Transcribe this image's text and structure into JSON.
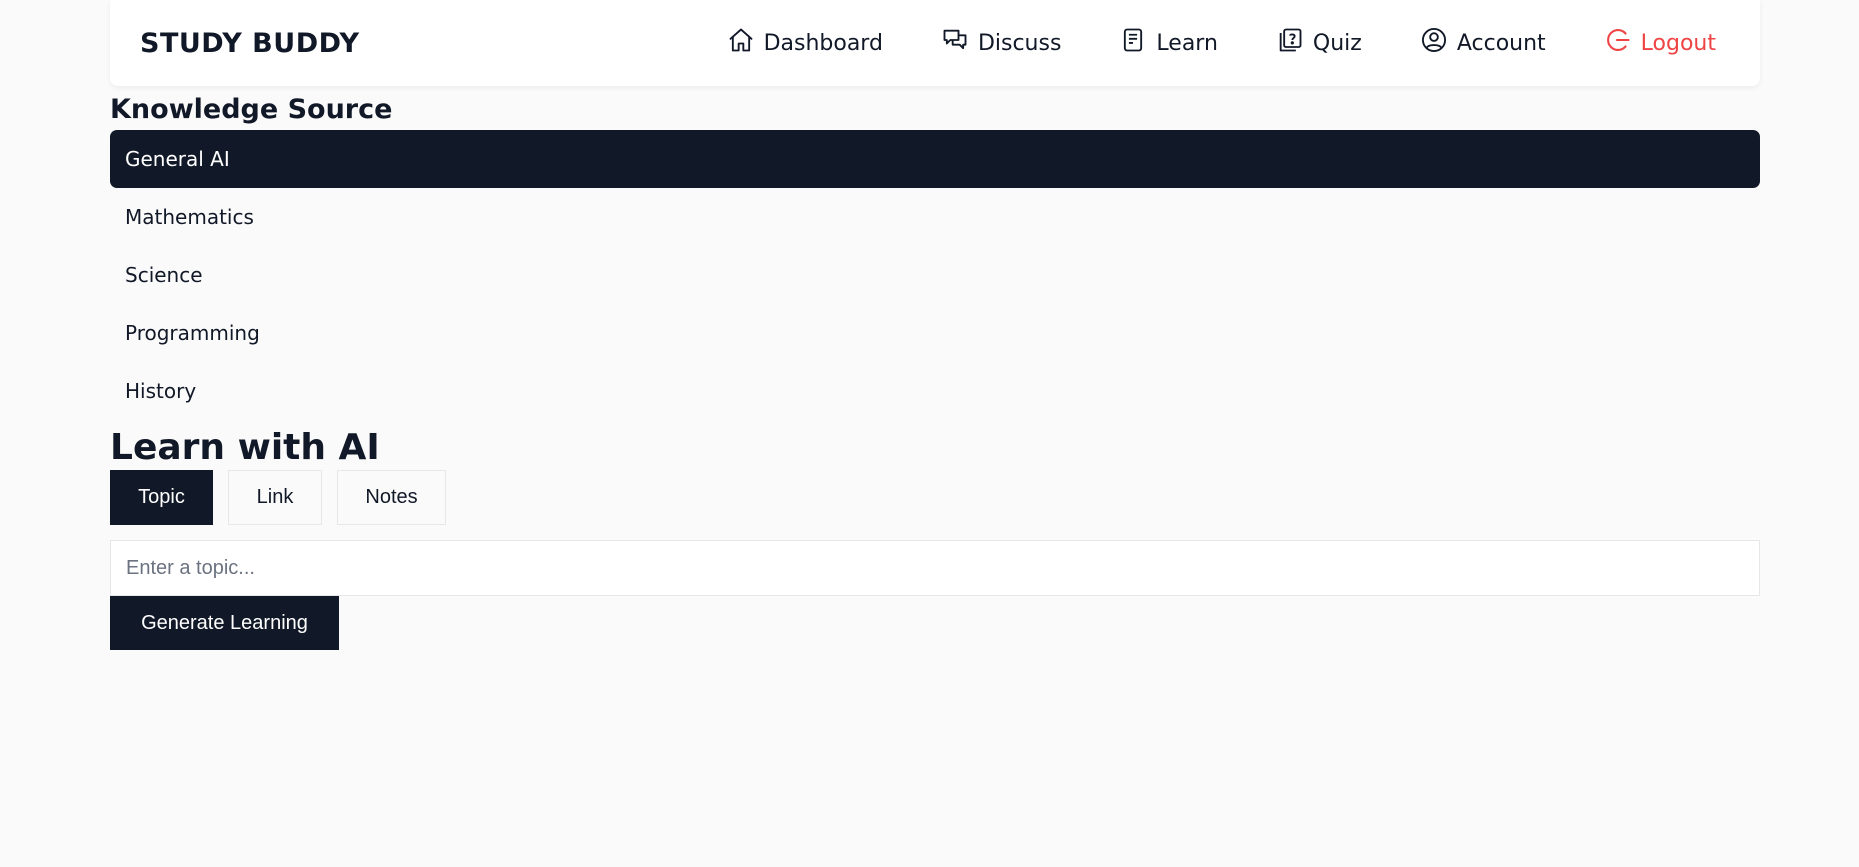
{
  "brand": "STUDY BUDDY",
  "nav": {
    "dashboard": "Dashboard",
    "discuss": "Discuss",
    "learn": "Learn",
    "quiz": "Quiz",
    "account": "Account",
    "logout": "Logout"
  },
  "knowledge_source": {
    "title": "Knowledge Source",
    "items": [
      "General AI",
      "Mathematics",
      "Science",
      "Programming",
      "History"
    ],
    "selected": "General AI"
  },
  "learn": {
    "title": "Learn with AI",
    "tabs": [
      "Topic",
      "Link",
      "Notes"
    ],
    "active_tab": "Topic",
    "input_placeholder": "Enter a topic...",
    "input_value": "",
    "generate_label": "Generate Learning"
  },
  "colors": {
    "primary": "#111827",
    "background": "#fafafa",
    "logout": "#ef4444"
  }
}
